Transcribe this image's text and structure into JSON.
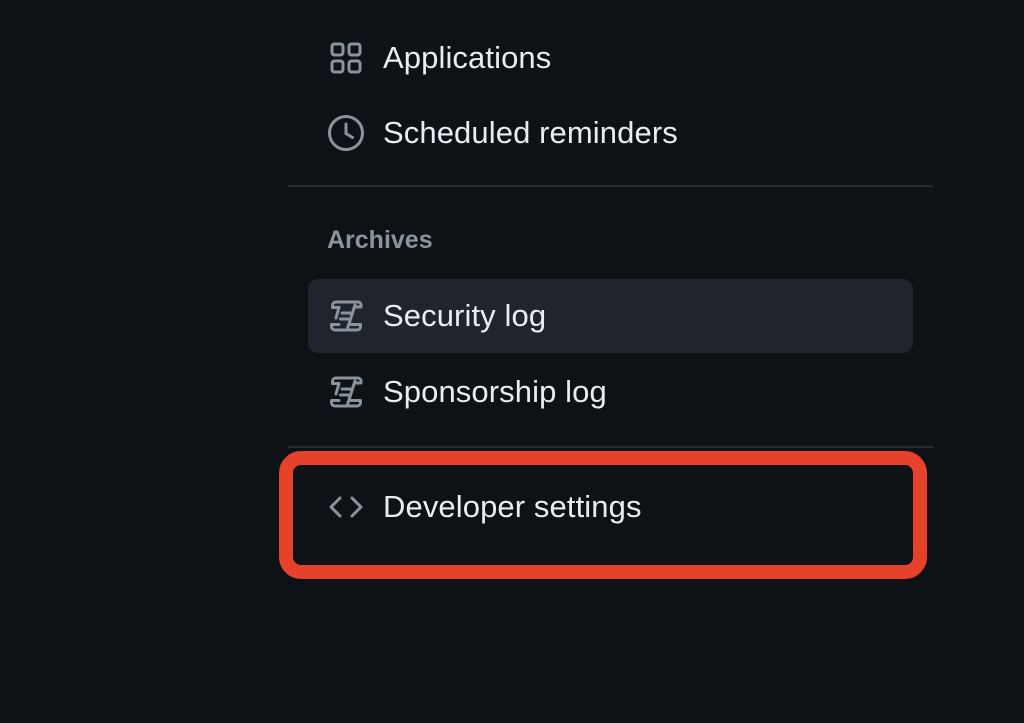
{
  "sidebar": {
    "items": [
      {
        "label": "Applications",
        "icon": "apps-grid-icon"
      },
      {
        "label": "Scheduled reminders",
        "icon": "clock-icon"
      }
    ],
    "archives": {
      "heading": "Archives",
      "items": [
        {
          "label": "Security log",
          "icon": "log-icon",
          "active": true
        },
        {
          "label": "Sponsorship log",
          "icon": "log-icon",
          "active": false
        }
      ]
    },
    "developer": {
      "label": "Developer settings",
      "icon": "code-icon"
    }
  },
  "annotation": {
    "highlight_color": "#e5412b",
    "highlight_target": "Developer settings"
  },
  "colors": {
    "background": "#0e1116",
    "active_item_bg": "#20242c",
    "text": "#e6edf3",
    "muted_text": "#8b949e",
    "icon": "#8b949e",
    "divider": "#262a31"
  }
}
